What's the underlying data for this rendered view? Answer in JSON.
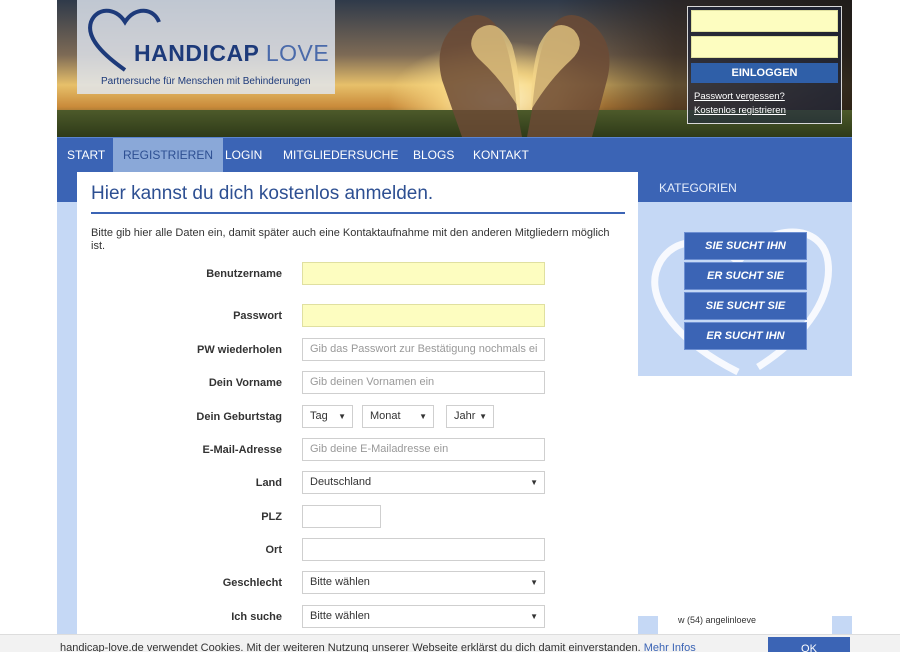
{
  "header": {
    "logo_title_main": "HANDICAP",
    "logo_title_love": "LOVE",
    "logo_subtitle": "Partnersuche für Menschen mit Behinderungen",
    "login_button": "EINLOGGEN",
    "forgot_password": "Passwort vergessen?",
    "register_free": "Kostenlos registrieren"
  },
  "nav": {
    "items": [
      {
        "label": "START"
      },
      {
        "label": "REGISTRIEREN"
      },
      {
        "label": "LOGIN"
      },
      {
        "label": "MITGLIEDERSUCHE"
      },
      {
        "label": "BLOGS"
      },
      {
        "label": "KONTAKT"
      }
    ],
    "active": "REGISTRIEREN"
  },
  "main": {
    "title": "Hier kannst du dich kostenlos anmelden.",
    "intro": "Bitte gib hier alle Daten ein, damit später auch eine Kontaktaufnahme mit den anderen Mitgliedern möglich ist.",
    "form": {
      "username_label": "Benutzername",
      "password_label": "Passwort",
      "password_repeat_label": "PW wiederholen",
      "password_repeat_placeholder": "Gib das Passwort zur Bestätigung nochmals ei",
      "firstname_label": "Dein Vorname",
      "firstname_placeholder": "Gib deinen Vornamen ein",
      "birthday_label": "Dein Geburtstag",
      "day_value": "Tag",
      "month_value": "Monat",
      "year_value": "Jahr",
      "email_label": "E-Mail-Adresse",
      "email_placeholder": "Gib deine E-Mailadresse ein",
      "country_label": "Land",
      "country_value": "Deutschland",
      "zip_label": "PLZ",
      "city_label": "Ort",
      "gender_label": "Geschlecht",
      "gender_value": "Bitte wählen",
      "seeking_label": "Ich suche",
      "seeking_value": "Bitte wählen"
    }
  },
  "sidebar": {
    "heading": "KATEGORIEN",
    "categories": [
      {
        "label": "SIE SUCHT IHN"
      },
      {
        "label": "ER SUCHT SIE"
      },
      {
        "label": "SIE SUCHT SIE"
      },
      {
        "label": "ER SUCHT IHN"
      }
    ],
    "member_preview": "w (54) angelinloeve"
  },
  "cookie": {
    "text": "handicap-love.de verwendet Cookies. Mit der weiteren Nutzung unserer Webseite erklärst du dich damit einverstanden.",
    "link": "Mehr Infos",
    "ok": "OK"
  },
  "colors": {
    "brand_blue": "#3b64b5",
    "light_blue": "#c5d8f5",
    "input_yellow": "#fdfdc0",
    "title_blue": "#2d4f92"
  }
}
